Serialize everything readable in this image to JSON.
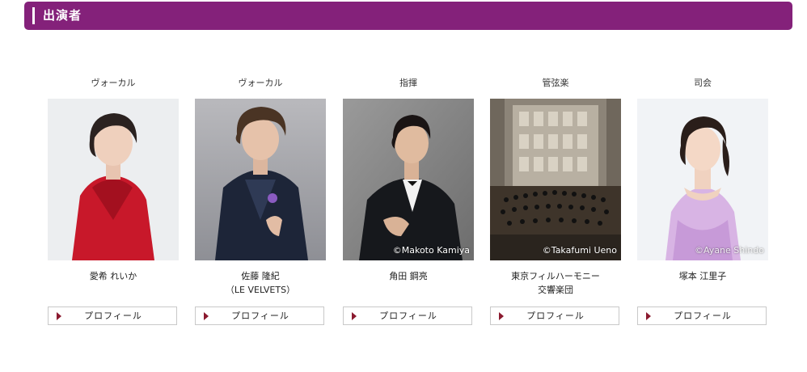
{
  "section": {
    "title": "出演者"
  },
  "performers": [
    {
      "role": "ヴォーカル",
      "name_line1": "愛希 れいか",
      "name_line2": "",
      "photo_credit": "",
      "profile_label": "プロフィール"
    },
    {
      "role": "ヴォーカル",
      "name_line1": "佐藤 隆紀",
      "name_line2": "（LE VELVETS）",
      "photo_credit": "",
      "profile_label": "プロフィール"
    },
    {
      "role": "指揮",
      "name_line1": "角田 鋼亮",
      "name_line2": "",
      "photo_credit": "©Makoto Kamiya",
      "profile_label": "プロフィール"
    },
    {
      "role": "管弦楽",
      "name_line1": "東京フィルハーモニー",
      "name_line2": "交響楽団",
      "photo_credit": "©Takafumi Ueno",
      "profile_label": "プロフィール"
    },
    {
      "role": "司会",
      "name_line1": "塚本 江里子",
      "name_line2": "",
      "photo_credit": "©Ayane Shindo",
      "profile_label": "プロフィール"
    }
  ],
  "colors": {
    "header_bg": "#84217a",
    "arrow": "#8b1a2f",
    "button_border": "#c9c9c9"
  }
}
